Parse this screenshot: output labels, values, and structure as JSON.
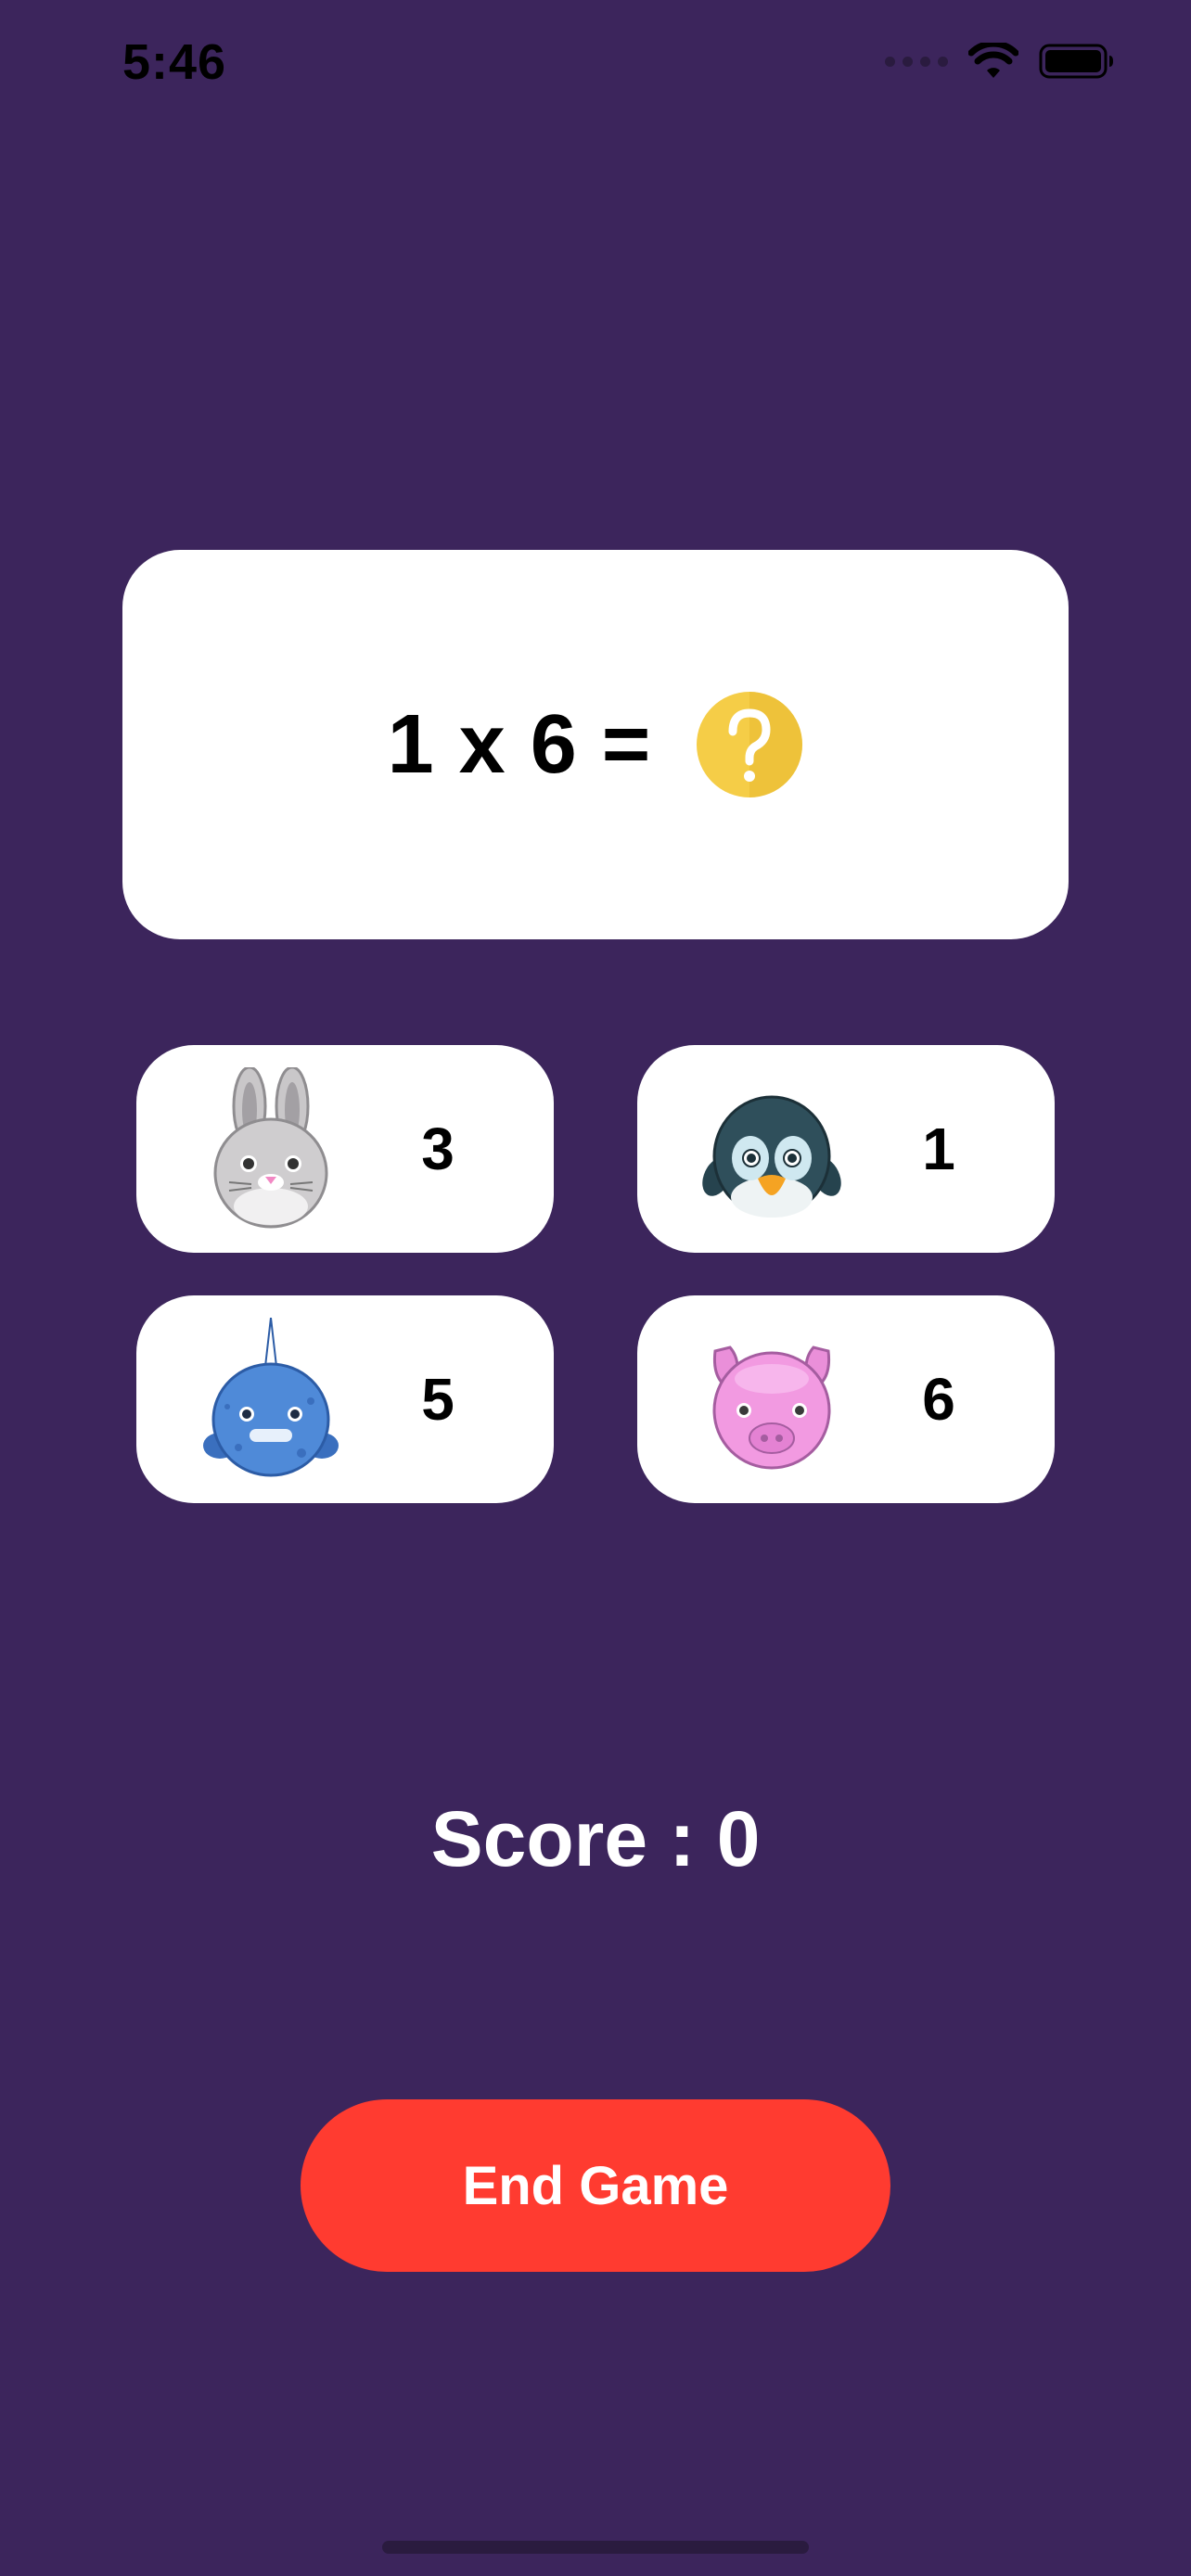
{
  "status_bar": {
    "time": "5:46",
    "icons": [
      "cellular-signal-icon",
      "wifi-icon",
      "battery-icon"
    ]
  },
  "question": {
    "text": "1 x 6 =",
    "unknown_icon": "question-mark-icon"
  },
  "answers": [
    {
      "animal": "rabbit",
      "value": "3"
    },
    {
      "animal": "penguin",
      "value": "1"
    },
    {
      "animal": "narwhal",
      "value": "5"
    },
    {
      "animal": "pig",
      "value": "6"
    }
  ],
  "score": {
    "text": "Score : 0"
  },
  "end_button": {
    "label": "End Game"
  },
  "colors": {
    "background": "#3c255c",
    "card": "#ffffff",
    "end_button": "#ff3b30",
    "question_icon": "#f5cd47"
  }
}
